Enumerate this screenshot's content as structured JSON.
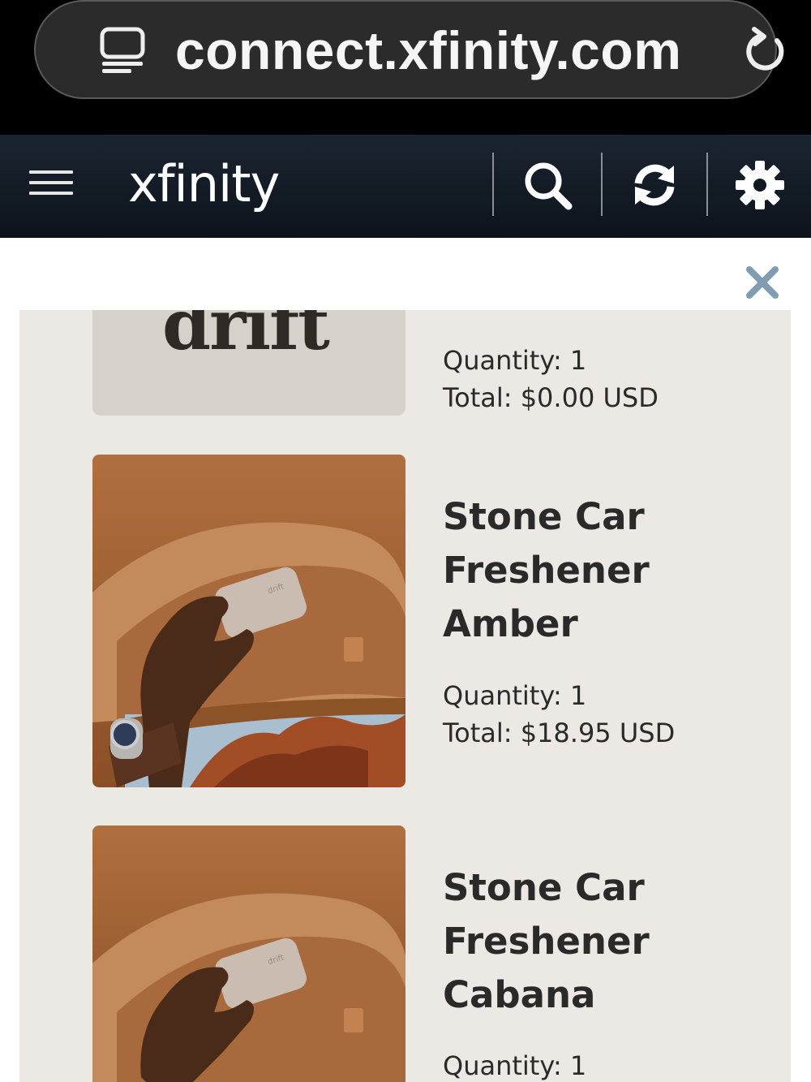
{
  "browser": {
    "url": "connect.xfinity.com"
  },
  "header": {
    "brand": "xfinity"
  },
  "icons": {
    "reader": "reader-mode-icon",
    "reload": "reload-icon",
    "menu": "hamburger-menu-icon",
    "search": "search-icon",
    "refresh": "refresh-icon",
    "settings": "gear-icon",
    "close": "close-icon"
  },
  "colors": {
    "header_bg": "#0c131b",
    "panel_bg": "#ece9e4",
    "close_x": "#7f9cb0"
  },
  "items": [
    {
      "image_text": "drift",
      "quantity": "Quantity: 1",
      "total": "Total: $0.00 USD"
    },
    {
      "title_lines": [
        "Stone Car",
        "Freshener",
        "Amber"
      ],
      "image_text": "drift",
      "quantity": "Quantity: 1",
      "total": "Total: $18.95 USD"
    },
    {
      "title_lines": [
        "Stone Car",
        "Freshener",
        "Cabana"
      ],
      "image_text": "drift",
      "quantity": "Quantity: 1"
    }
  ]
}
